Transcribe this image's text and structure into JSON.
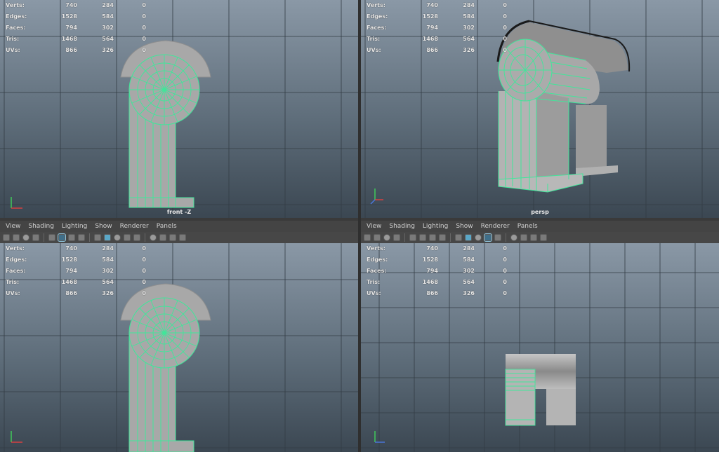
{
  "menu": [
    "View",
    "Shading",
    "Lighting",
    "Show",
    "Renderer",
    "Panels"
  ],
  "hud": [
    {
      "label": "Verts:",
      "a": "740",
      "b": "284",
      "c": "0"
    },
    {
      "label": "Edges:",
      "a": "1528",
      "b": "584",
      "c": "0"
    },
    {
      "label": "Faces:",
      "a": "794",
      "b": "302",
      "c": "0"
    },
    {
      "label": "Tris:",
      "a": "1468",
      "b": "564",
      "c": "0"
    },
    {
      "label": "UVs:",
      "a": "866",
      "b": "326",
      "c": "0"
    }
  ],
  "viewports": {
    "top_left": {
      "camera": "front -Z"
    },
    "top_right": {
      "camera": "persp"
    }
  },
  "colors": {
    "wire": "#3fe79a",
    "mesh": "#a6a6a6",
    "bg_top": "#8a98a6",
    "bg_bottom": "#3b4752"
  },
  "toolbar_icons": [
    "camera-icon",
    "lock-icon",
    "bookmark-icon",
    "pen-icon",
    "grid-icon",
    "wireframe-icon",
    "smooth-shade-icon",
    "texture-icon",
    "light-icon",
    "shadow-icon",
    "xray-icon",
    "isolate-icon",
    "resolution-icon"
  ]
}
